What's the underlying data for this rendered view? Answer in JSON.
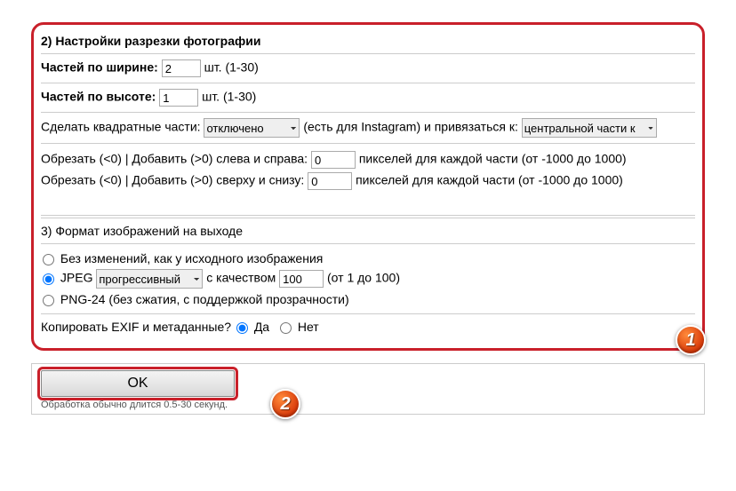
{
  "section2": {
    "title": "2) Настройки разрезки фотографии",
    "width_label": "Частей по ширине:",
    "width_value": "2",
    "width_hint": "шт. (1-30)",
    "height_label": "Частей по высоте:",
    "height_value": "1",
    "height_hint": "шт. (1-30)",
    "square_label": "Сделать квадратные части:",
    "square_option": "отключено",
    "square_hint1": "(есть для Instagram) и привязаться к:",
    "square_anchor_option": "центральной части к",
    "crop_lr_label": "Обрезать (<0) | Добавить (>0) слева и справа:",
    "crop_lr_value": "0",
    "crop_lr_hint": "пикселей для каждой части (от -1000 до 1000)",
    "crop_tb_label": "Обрезать (<0) | Добавить (>0) сверху и снизу:",
    "crop_tb_value": "0",
    "crop_tb_hint": "пикселей для каждой части (от -1000 до 1000)"
  },
  "section3": {
    "title": "3) Формат изображений на выходе",
    "opt_same": "Без изменений, как у исходного изображения",
    "opt_jpeg": "JPEG",
    "jpeg_mode": "прогрессивный",
    "jpeg_q_label": "с качеством",
    "jpeg_q_value": "100",
    "jpeg_q_hint": "(от 1 до 100)",
    "opt_png": "PNG-24 (без сжатия, с поддержкой прозрачности)",
    "exif_label": "Копировать EXIF и метаданные?",
    "exif_yes": "Да",
    "exif_no": "Нет"
  },
  "footer": {
    "ok": "OK",
    "hint": "Обработка обычно длится 0.5-30 секунд."
  },
  "badges": {
    "one": "1",
    "two": "2"
  }
}
